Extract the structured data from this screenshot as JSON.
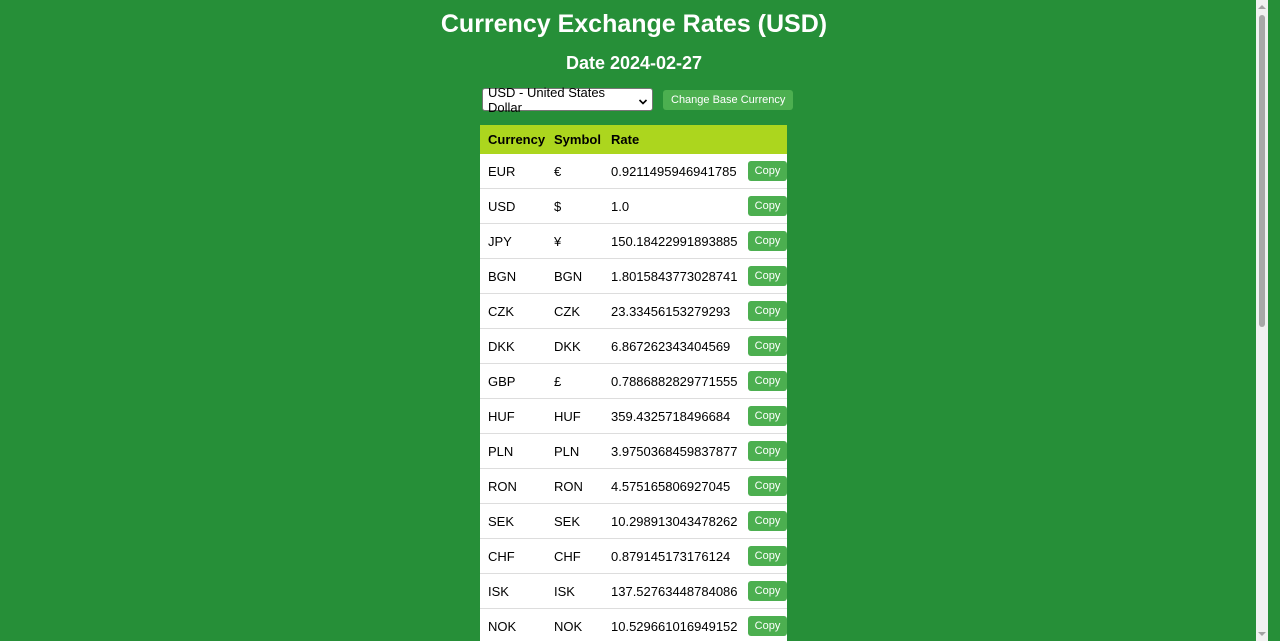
{
  "header": {
    "title": "Currency Exchange Rates (USD)",
    "date_label": "Date",
    "date_value": "2024-02-27"
  },
  "controls": {
    "base_currency_selected": "USD - United States Dollar",
    "change_button_label": "Change Base Currency"
  },
  "table": {
    "headers": [
      "Currency",
      "Symbol",
      "Rate"
    ],
    "copy_label": "Copy",
    "rows": [
      {
        "currency": "EUR",
        "symbol": "€",
        "rate": "0.9211495946941785"
      },
      {
        "currency": "USD",
        "symbol": "$",
        "rate": "1.0"
      },
      {
        "currency": "JPY",
        "symbol": "¥",
        "rate": "150.18422991893885"
      },
      {
        "currency": "BGN",
        "symbol": "BGN",
        "rate": "1.8015843773028741"
      },
      {
        "currency": "CZK",
        "symbol": "CZK",
        "rate": "23.33456153279293"
      },
      {
        "currency": "DKK",
        "symbol": "DKK",
        "rate": "6.867262343404569"
      },
      {
        "currency": "GBP",
        "symbol": "£",
        "rate": "0.7886882829771555"
      },
      {
        "currency": "HUF",
        "symbol": "HUF",
        "rate": "359.4325718496684"
      },
      {
        "currency": "PLN",
        "symbol": "PLN",
        "rate": "3.9750368459837877"
      },
      {
        "currency": "RON",
        "symbol": "RON",
        "rate": "4.575165806927045"
      },
      {
        "currency": "SEK",
        "symbol": "SEK",
        "rate": "10.298913043478262"
      },
      {
        "currency": "CHF",
        "symbol": "CHF",
        "rate": "0.879145173176124"
      },
      {
        "currency": "ISK",
        "symbol": "ISK",
        "rate": "137.52763448784086"
      },
      {
        "currency": "NOK",
        "symbol": "NOK",
        "rate": "10.529661016949152"
      }
    ]
  },
  "colors": {
    "background": "#268f38",
    "table_header": "#acd61e",
    "button": "#4caf50"
  }
}
